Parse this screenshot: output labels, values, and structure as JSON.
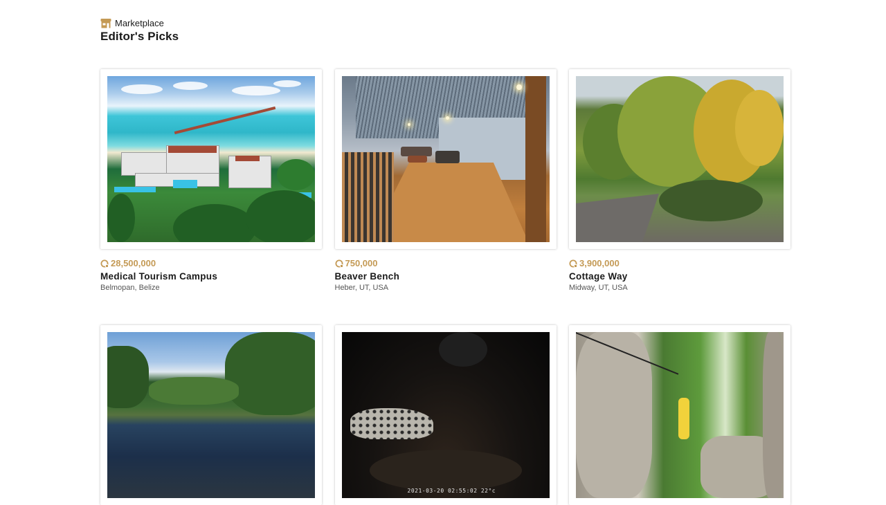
{
  "header": {
    "section_icon": "store-icon",
    "section_label": "Marketplace",
    "title": "Editor's Picks"
  },
  "colors": {
    "accent": "#c49a55",
    "text": "#1a1a1a",
    "muted": "#555555"
  },
  "listings": [
    {
      "price": "28,500,000",
      "name": "Medical Tourism Campus",
      "location": "Belmopan, Belize",
      "photo": "tropical resort aerial view"
    },
    {
      "price": "750,000",
      "name": "Beaver Bench",
      "location": "Heber, UT, USA",
      "photo": "attic loft room"
    },
    {
      "price": "3,900,000",
      "name": "Cottage Way",
      "location": "Midway, UT, USA",
      "photo": "autumn trees and driveway"
    },
    {
      "price": "",
      "name": "",
      "location": "",
      "photo": "river and jungle"
    },
    {
      "price": "",
      "name": "",
      "location": "",
      "photo": "night camera ocelot",
      "stamp": "2021-03-20 02:55:02 22°c"
    },
    {
      "price": "",
      "name": "",
      "location": "",
      "photo": "cave zipline"
    }
  ]
}
